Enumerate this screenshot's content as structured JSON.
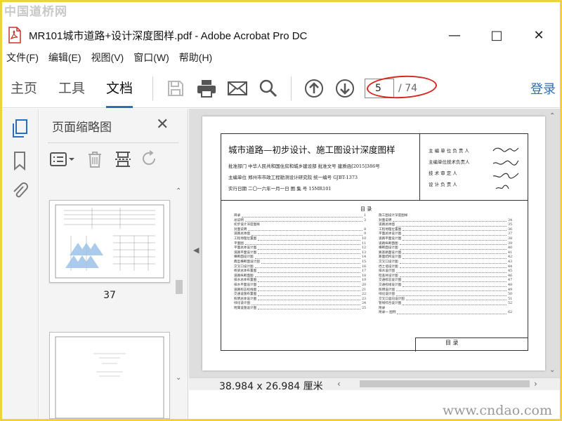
{
  "watermarks": {
    "top": "中国道桥网",
    "bottom": "www.cndao.com"
  },
  "titlebar": {
    "title": "MR101城市道路+设计深度图样.pdf - Adobe Acrobat Pro DC"
  },
  "menu": {
    "items": [
      "文件(F)",
      "编辑(E)",
      "视图(V)",
      "窗口(W)",
      "帮助(H)"
    ]
  },
  "nav": {
    "tabs": [
      "主页",
      "工具",
      "文档"
    ],
    "active": "文档"
  },
  "toolbar": {
    "page_current": "5",
    "page_total": "/ 74",
    "login": "登录",
    "accent": "#2a6ebb",
    "highlight": "#d9251d"
  },
  "thumbnails": {
    "title": "页面缩略图",
    "page_label": "37"
  },
  "document": {
    "size_label": "38.984 x 26.984 厘米",
    "sheet": {
      "title": "城市道路—初步设计、施工图设计深度图样",
      "line1": "批准部门  中华人民共和国住房和城乡建设部        批准文号  建质函[2015]386号",
      "line2": "主编单位  郑州市市政工程勘测设计研究院            统一编号  GJBT-1373",
      "line3": "实行日期  二〇一六年一月一日                        图 集 号  15MR101",
      "right_rows": [
        "主 编 单 位 负 责 人",
        "主编单位技术负责人",
        "技  术  审  定  人",
        "设  计  负  责  人"
      ],
      "toc_heading": "目          录",
      "titleblock": "目   录",
      "toc_left": [
        [
          "目录",
          "1"
        ],
        [
          "总说明",
          "3"
        ],
        [
          "初步设计深度图样",
          ""
        ],
        [
          "封面说明",
          "8"
        ],
        [
          "道路总体图",
          "9"
        ],
        [
          "工程地理位置图",
          "10"
        ],
        [
          "平面图",
          "11"
        ],
        [
          "平面总体设计图",
          "12"
        ],
        [
          "道路平面设计图",
          "13"
        ],
        [
          "横断面设计图",
          "14"
        ],
        [
          "典型横断面设计图",
          "15"
        ],
        [
          "交叉口设计图",
          "16"
        ],
        [
          "桥梁总体布置图",
          "17"
        ],
        [
          "道路纵断面图",
          "18"
        ],
        [
          "排水总体布置图",
          "19"
        ],
        [
          "排水平面设计图",
          "20"
        ],
        [
          "道路标志标线图",
          "21"
        ],
        [
          "交通设施布置图",
          "22"
        ],
        [
          "照明总体设计图",
          "23"
        ],
        [
          "绿化设计图",
          "24"
        ],
        [
          "附属设施设计图",
          "25"
        ]
      ],
      "toc_right": [
        [
          "施工图设计深度图样",
          ""
        ],
        [
          "封面说明",
          "34"
        ],
        [
          "道路总体图",
          "35"
        ],
        [
          "工程地理位置图",
          "36"
        ],
        [
          "平面总体设计图",
          "37"
        ],
        [
          "道路平面设计图",
          "38"
        ],
        [
          "道路纵断面图",
          "39"
        ],
        [
          "横断面设计图",
          "40"
        ],
        [
          "路基路面设计图",
          "41"
        ],
        [
          "路面结构设计图",
          "42"
        ],
        [
          "交叉口设计图",
          "43"
        ],
        [
          "挡土墙设计图",
          "44"
        ],
        [
          "排水设计图",
          "45"
        ],
        [
          "检查井设计图",
          "46"
        ],
        [
          "交通标志设计图",
          "47"
        ],
        [
          "交通标线设计图",
          "48"
        ],
        [
          "照明设计图",
          "49"
        ],
        [
          "绿化设计图",
          "50"
        ],
        [
          "交叉口竖向设计图",
          "51"
        ],
        [
          "管线综合设计图",
          "52"
        ],
        [
          "附录",
          ""
        ],
        [
          "附录一 图例",
          "62"
        ]
      ]
    }
  }
}
